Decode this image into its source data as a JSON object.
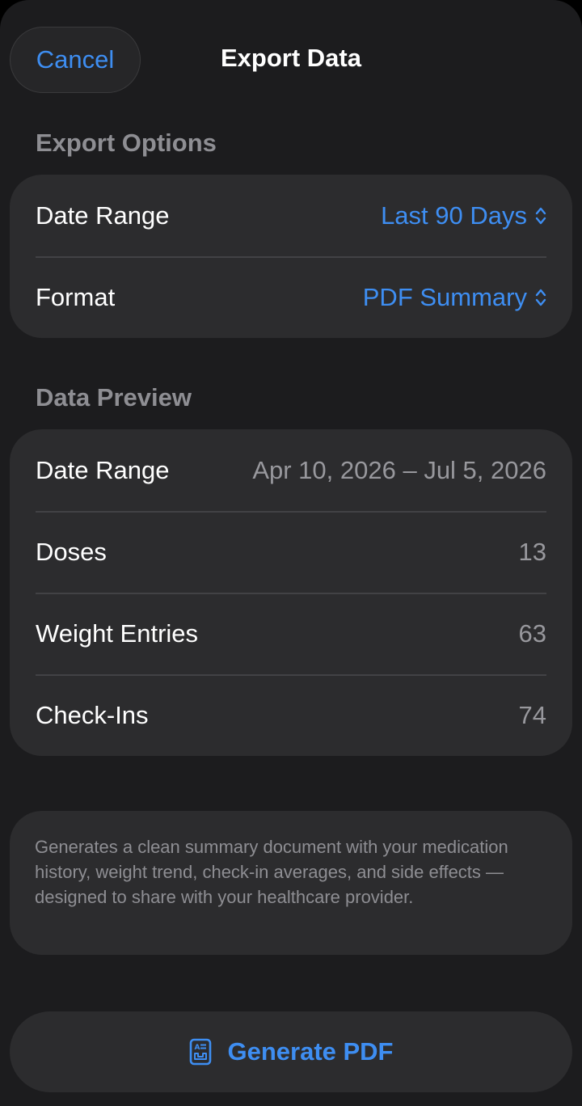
{
  "nav": {
    "cancel_label": "Cancel",
    "title": "Export Data"
  },
  "export_options": {
    "header": "Export Options",
    "rows": [
      {
        "label": "Date Range",
        "value": "Last 90 Days"
      },
      {
        "label": "Format",
        "value": "PDF Summary"
      }
    ]
  },
  "data_preview": {
    "header": "Data Preview",
    "rows": [
      {
        "label": "Date Range",
        "value": "Apr 10, 2026 – Jul 5, 2026"
      },
      {
        "label": "Doses",
        "value": "13"
      },
      {
        "label": "Weight Entries",
        "value": "63"
      },
      {
        "label": "Check-Ins",
        "value": "74"
      }
    ]
  },
  "note": {
    "text": "Generates a clean summary document with your medication history, weight trend, check-in averages, and side effects — designed to share with your healthcare provider."
  },
  "generate_button": {
    "label": "Generate PDF",
    "icon": "document-text-icon"
  },
  "picker_icon": "chevron-up-down-icon",
  "colors": {
    "accent": "#3e8ef2",
    "background": "#1c1c1e",
    "card": "#2c2c2e",
    "secondary_text": "#8e8e93"
  }
}
